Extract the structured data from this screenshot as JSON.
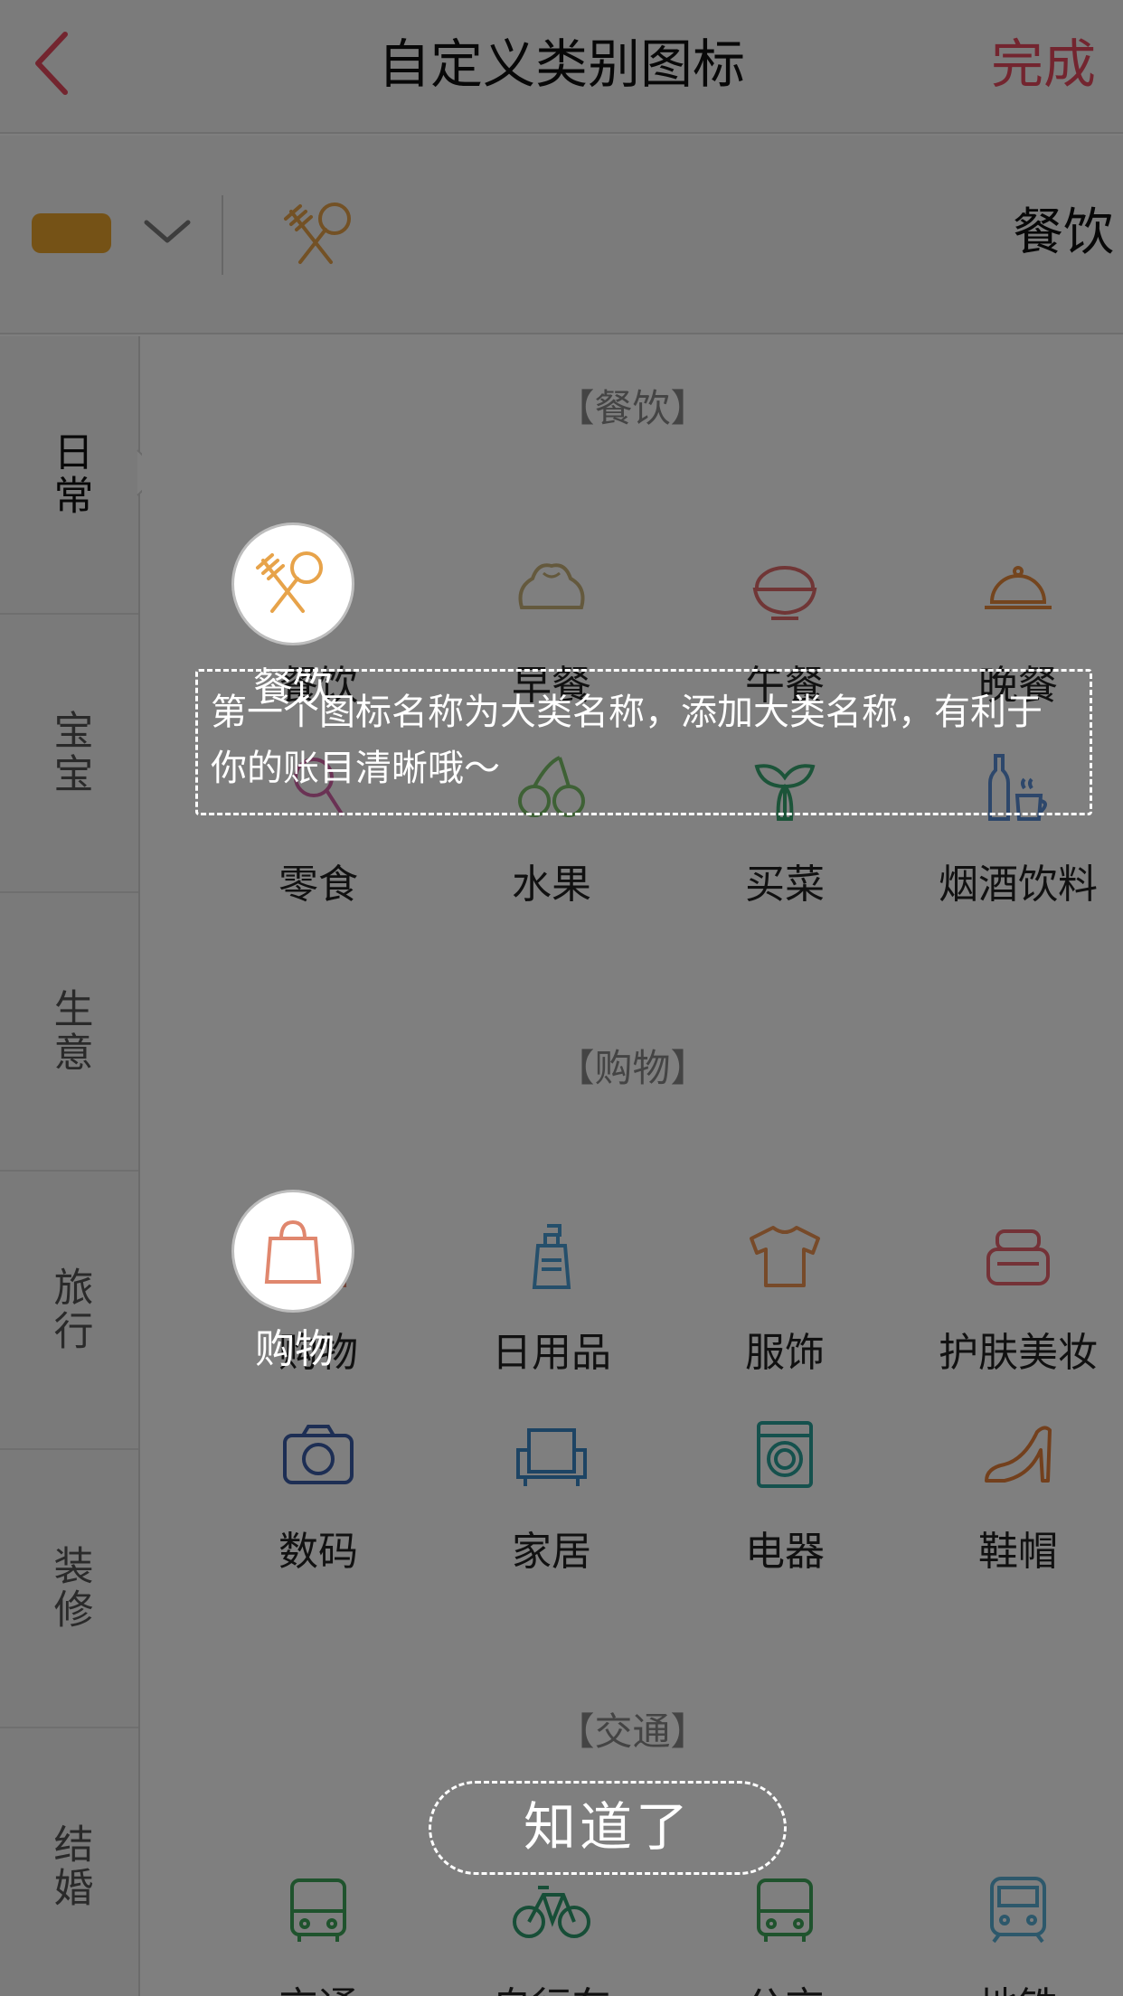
{
  "header": {
    "title": "自定义类别图标",
    "done_label": "完成",
    "back_icon": "chevron-left-icon"
  },
  "selector": {
    "color": "#eaa52c",
    "selected_name": "餐饮",
    "selected_icon": "fork-spoon-icon"
  },
  "sidebar": {
    "items": [
      {
        "label": "日常",
        "active": true
      },
      {
        "label": "宝宝",
        "active": false
      },
      {
        "label": "生意",
        "active": false
      },
      {
        "label": "旅行",
        "active": false
      },
      {
        "label": "装修",
        "active": false
      },
      {
        "label": "结婚",
        "active": false
      }
    ]
  },
  "sections": [
    {
      "title": "【餐饮】",
      "items": [
        {
          "label": "餐饮",
          "icon": "fork-spoon-icon",
          "color": "#e7a34a"
        },
        {
          "label": "早餐",
          "icon": "bun-icon",
          "color": "#c9b37a"
        },
        {
          "label": "午餐",
          "icon": "rice-bowl-icon",
          "color": "#e06c6c"
        },
        {
          "label": "晚餐",
          "icon": "cloche-icon",
          "color": "#e88a3c"
        },
        {
          "label": "零食",
          "icon": "lollipop-icon",
          "color": "#d565a8"
        },
        {
          "label": "水果",
          "icon": "cherry-icon",
          "color": "#7cc26b"
        },
        {
          "label": "买菜",
          "icon": "vegetable-icon",
          "color": "#39a872"
        },
        {
          "label": "烟酒饮料",
          "icon": "bottle-cup-icon",
          "color": "#5b8fd6"
        }
      ]
    },
    {
      "title": "【购物】",
      "items": [
        {
          "label": "购物",
          "icon": "shopping-bag-icon",
          "color": "#e0876e"
        },
        {
          "label": "日用品",
          "icon": "pump-bottle-icon",
          "color": "#4a9fd6"
        },
        {
          "label": "服饰",
          "icon": "tshirt-icon",
          "color": "#ef9553"
        },
        {
          "label": "护肤美妆",
          "icon": "cream-jar-icon",
          "color": "#e8656f"
        },
        {
          "label": "数码",
          "icon": "camera-icon",
          "color": "#3b5ca8"
        },
        {
          "label": "家居",
          "icon": "armchair-icon",
          "color": "#3a88c9"
        },
        {
          "label": "电器",
          "icon": "washing-machine-icon",
          "color": "#2ba39b"
        },
        {
          "label": "鞋帽",
          "icon": "high-heel-icon",
          "color": "#e6813a"
        }
      ]
    },
    {
      "title": "【交通】",
      "items": [
        {
          "label": "交通",
          "icon": "bus-icon",
          "color": "#3fa65a"
        },
        {
          "label": "自行车",
          "icon": "bicycle-icon",
          "color": "#2f9c6f"
        },
        {
          "label": "公交",
          "icon": "bus-icon",
          "color": "#3fa65a"
        },
        {
          "label": "地铁",
          "icon": "metro-icon",
          "color": "#5ab0d6"
        }
      ]
    }
  ],
  "guide": {
    "tip": "第一个图标名称为大类名称，添加大类名称，有利于你的账目清晰哦～",
    "ack_label": "知道了",
    "highlight_1": "餐饮",
    "highlight_2": "购物"
  }
}
